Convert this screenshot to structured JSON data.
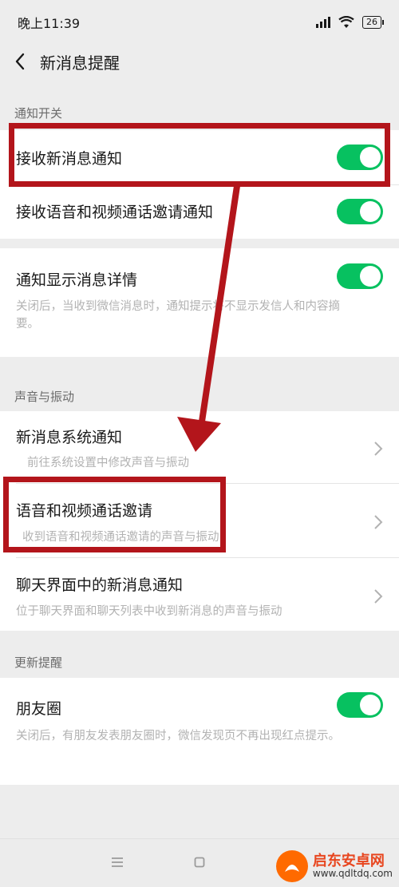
{
  "status_bar": {
    "time": "晚上11:39",
    "battery": "26"
  },
  "nav": {
    "title": "新消息提醒"
  },
  "sections": {
    "notify": {
      "header": "通知开关"
    },
    "sound": {
      "header": "声音与振动"
    },
    "update": {
      "header": "更新提醒"
    }
  },
  "cells": {
    "receive_new": {
      "title": "接收新消息通知",
      "toggle": "on"
    },
    "receive_call": {
      "title": "接收语音和视频通话邀请通知",
      "toggle": "on"
    },
    "show_detail": {
      "title": "通知显示消息详情",
      "desc": "关闭后，当收到微信消息时，通知提示将不显示发信人和内容摘要。",
      "toggle": "on"
    },
    "system_notify": {
      "title": "新消息系统通知",
      "desc": "前往系统设置中修改声音与振动"
    },
    "call_invite": {
      "title": "语音和视频通话邀请",
      "desc": "收到语音和视频通话邀请的声音与振动"
    },
    "chat_notify": {
      "title": "聊天界面中的新消息通知",
      "desc": "位于聊天界面和聊天列表中收到新消息的声音与振动"
    },
    "moments": {
      "title": "朋友圈",
      "desc": "关闭后，有朋友发表朋友圈时，微信发现页不再出现红点提示。",
      "toggle": "on"
    }
  },
  "watermark": {
    "title": "启东安卓网",
    "url": "www.qdltdq.com"
  },
  "colors": {
    "accent": "#07c160",
    "annotation": "#b3151b"
  }
}
